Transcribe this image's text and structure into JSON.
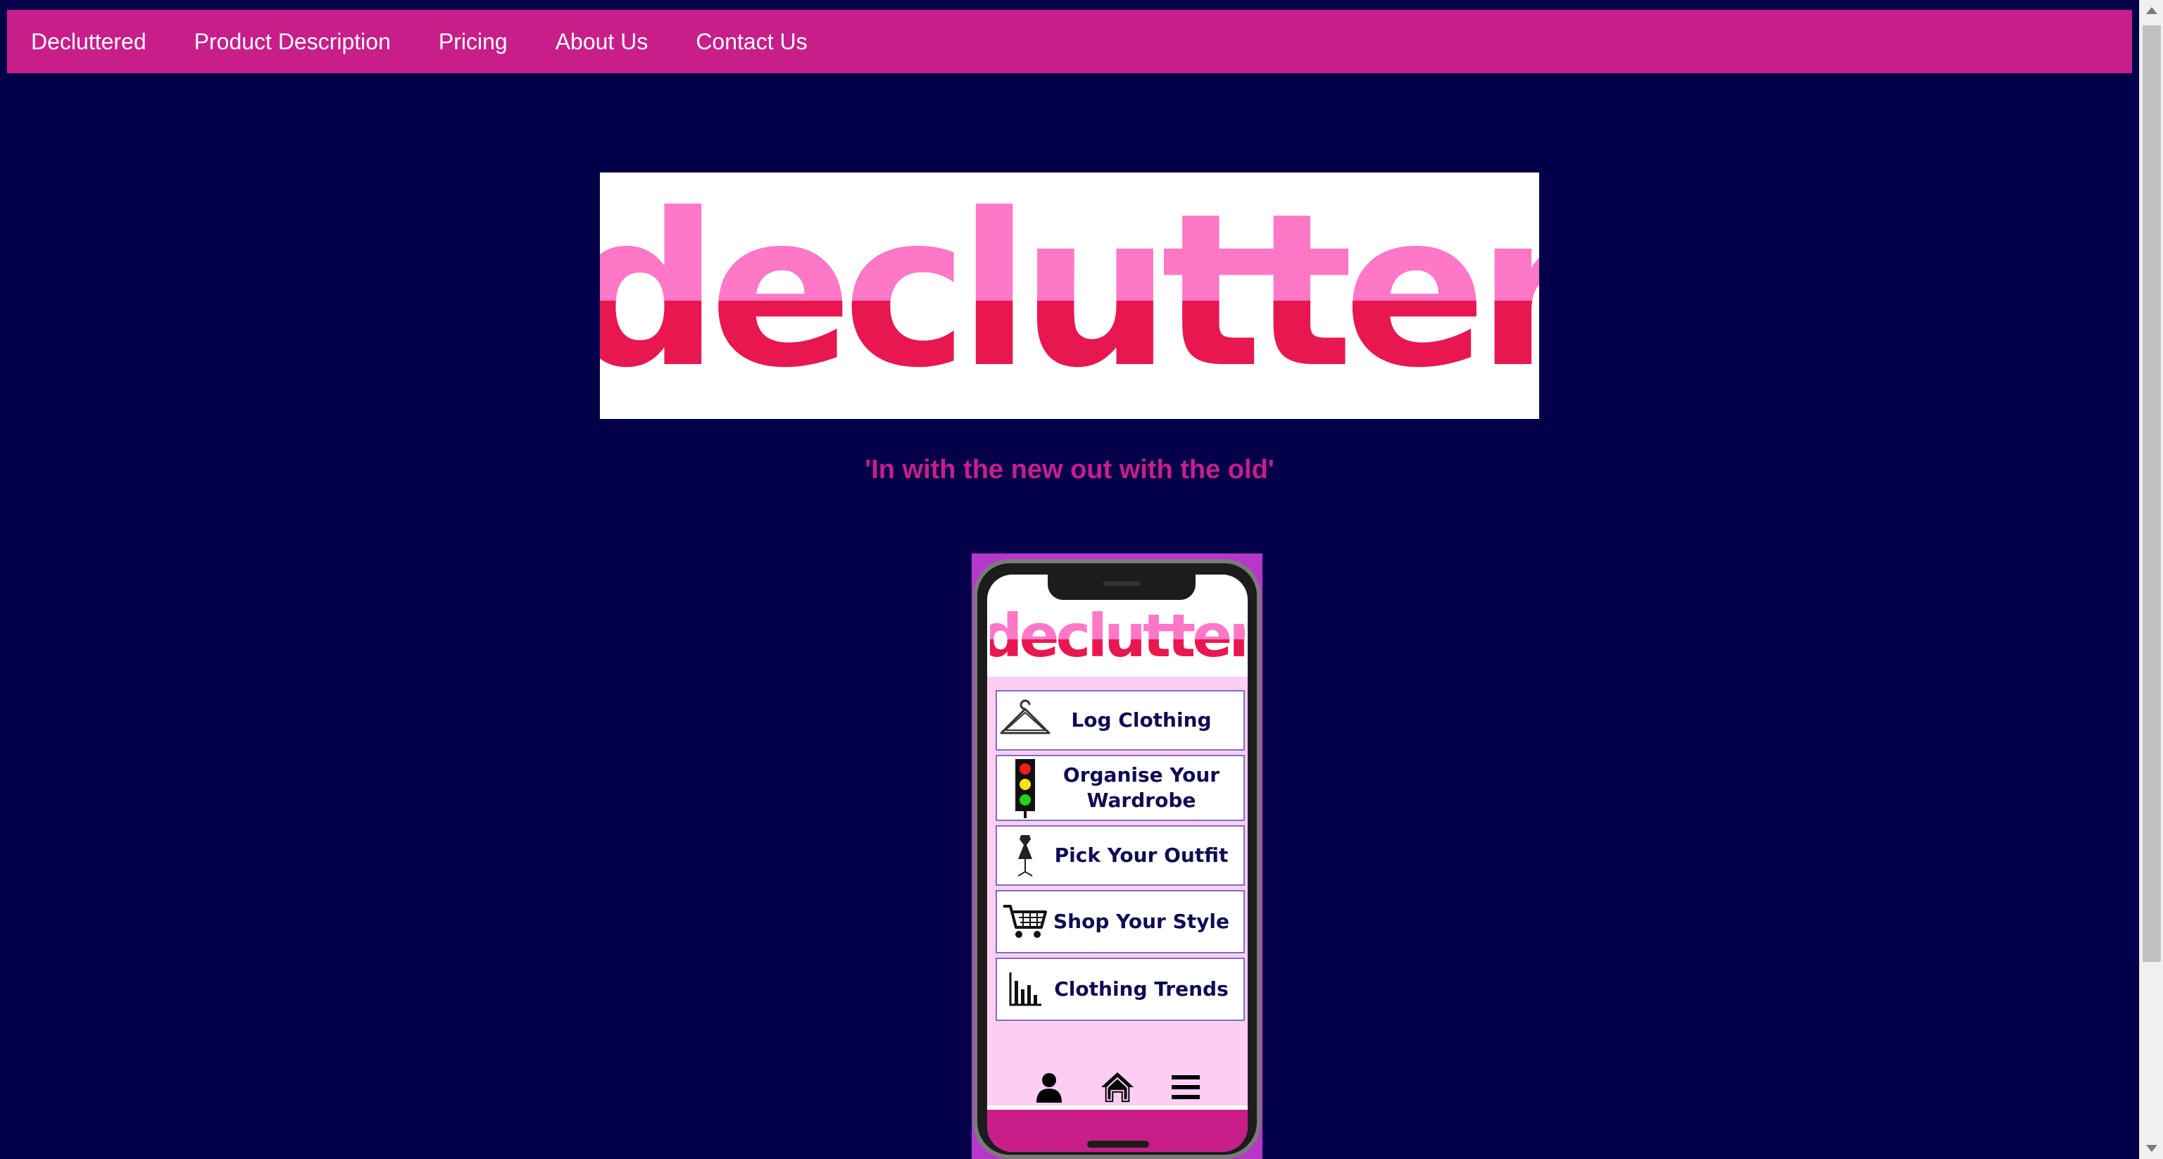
{
  "nav": {
    "items": [
      {
        "label": "Decluttered"
      },
      {
        "label": "Product Description"
      },
      {
        "label": "Pricing"
      },
      {
        "label": "About Us"
      },
      {
        "label": "Contact Us"
      }
    ]
  },
  "hero": {
    "logo_text": "declutter",
    "tagline": "'In with the new out with the old'"
  },
  "phone": {
    "logo_text": "declutter",
    "menu": [
      {
        "label": "Log Clothing",
        "icon": "hanger-icon"
      },
      {
        "label": "Organise Your Wardrobe",
        "icon": "traffic-light-icon"
      },
      {
        "label": "Pick Your Outfit",
        "icon": "dress-form-icon"
      },
      {
        "label": "Shop Your Style",
        "icon": "shopping-cart-icon"
      },
      {
        "label": "Clothing Trends",
        "icon": "bar-chart-icon"
      }
    ],
    "bottom_nav": [
      "user-icon",
      "home-icon",
      "hamburger-menu-icon"
    ]
  },
  "colors": {
    "background": "#03004a",
    "brand_pink": "#c71e8a",
    "logo_light_pink": "#ff78c8",
    "logo_dark_pink": "#e8174f",
    "phone_screen_bg": "#fecdf4",
    "menu_text": "#0e0c52"
  }
}
